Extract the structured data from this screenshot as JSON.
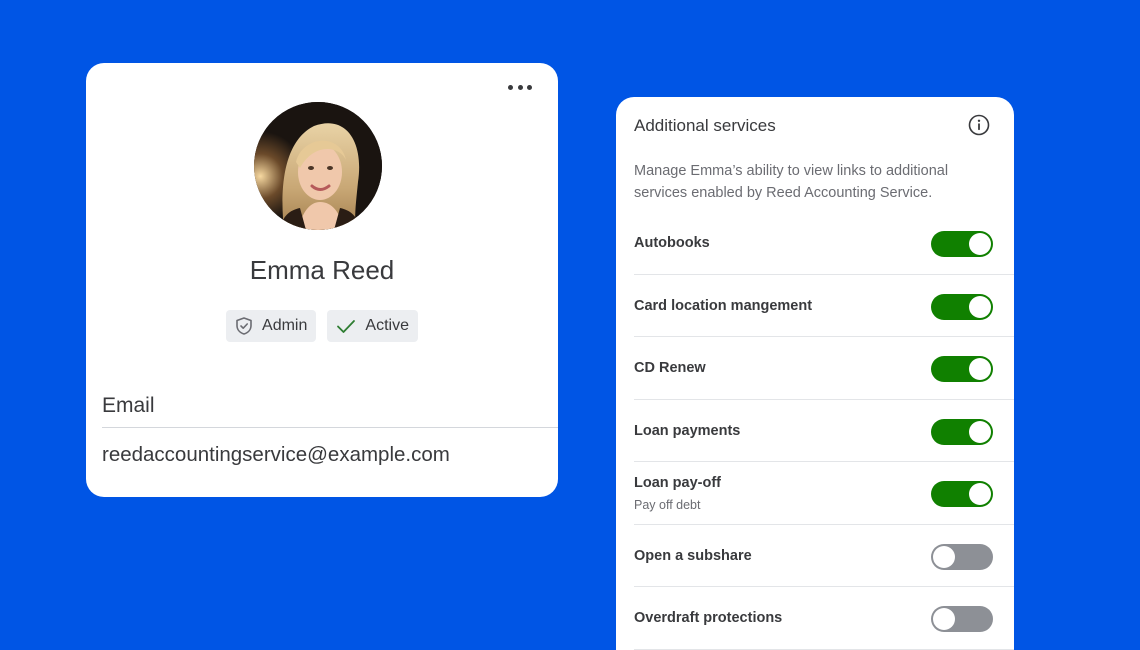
{
  "profile": {
    "name": "Emma Reed",
    "badges": [
      {
        "label": "Admin",
        "icon": "shield-icon"
      },
      {
        "label": "Active",
        "icon": "checkmark-icon"
      }
    ],
    "email_label": "Email",
    "email_value": "reedaccountingservice@example.com"
  },
  "services": {
    "title": "Additional services",
    "description": "Manage Emma’s ability to view links to additional services enabled by Reed Accounting Service.",
    "items": [
      {
        "label": "Autobooks",
        "sub": "",
        "enabled": true
      },
      {
        "label": "Card location mangement",
        "sub": "",
        "enabled": true
      },
      {
        "label": "CD Renew",
        "sub": "",
        "enabled": true
      },
      {
        "label": "Loan payments",
        "sub": "",
        "enabled": true
      },
      {
        "label": "Loan pay-off",
        "sub": "Pay off debt",
        "enabled": true
      },
      {
        "label": "Open a subshare",
        "sub": "",
        "enabled": false
      },
      {
        "label": "Overdraft protections",
        "sub": "",
        "enabled": false
      }
    ]
  },
  "colors": {
    "background": "#0055e5",
    "toggle_on": "#108000",
    "toggle_off": "#8d9096"
  }
}
